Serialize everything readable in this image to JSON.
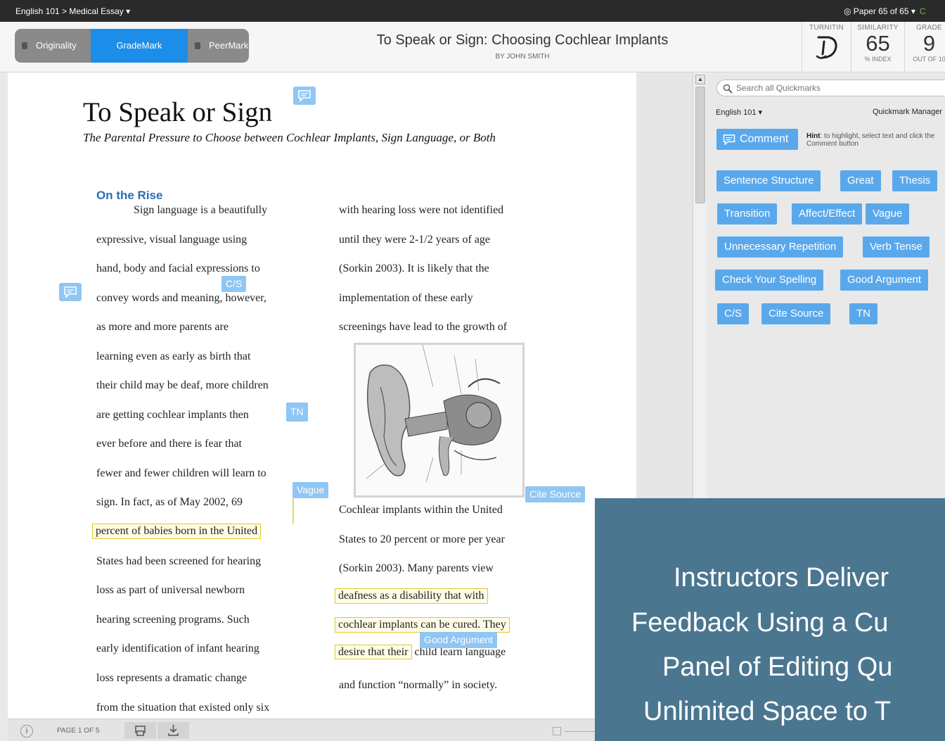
{
  "topbar": {
    "breadcrumb": "English 101 > Medical Essay ▾",
    "paper_nav": "◎  Paper 65 of 65 ▾",
    "next": "C"
  },
  "modes": {
    "originality": "Originality",
    "grademark": "GradeMark",
    "peermark": "PeerMark"
  },
  "document": {
    "title": "To Speak or Sign: Choosing Cochlear Implants",
    "author": "BY JOHN SMITH"
  },
  "scores": {
    "turnitin_label": "TURNITIN",
    "similarity_label": "SIMILARITY",
    "similarity_value": "65",
    "similarity_sub": "% INDEX",
    "grade_label": "GRADE",
    "grade_value": "9",
    "grade_sub": "OUT OF 10"
  },
  "essay": {
    "title": "To Speak or Sign",
    "subtitle": "The Parental Pressure to Choose between Cochlear Implants, Sign Language, or Both",
    "section_heading": "On the Rise",
    "col1": [
      "Sign language is a beautifully",
      "expressive, visual language using",
      "hand, body and facial expressions to",
      "convey words and meaning, however,",
      "as more and more parents are",
      "learning even as early as birth that",
      "their child may be deaf, more children",
      "are getting cochlear implants then",
      "ever before and there is fear that",
      "fewer and fewer children will learn to",
      "sign.  In fact, as of May 2002, 69",
      "percent of babies born in the United",
      "States had been screened for hearing",
      "loss as part of universal newborn",
      "hearing screening programs. Such",
      "early identification of infant hearing",
      "loss represents a dramatic change",
      "from the situation that existed only six"
    ],
    "col2_top": [
      "with hearing loss were not identified",
      "until they were 2-1/2 years of age",
      "(Sorkin 2003).  It is likely that the",
      "implementation of these early",
      "screenings have lead to the growth of"
    ],
    "col2_bottom": [
      "Cochlear implants within the United",
      "States to 20 percent or more per year",
      "(Sorkin 2003).  Many parents view",
      "deafness as a disability that with",
      "cochlear implants can be cured.  They",
      "desire that their",
      " child learn language",
      "and function “normally” in society."
    ],
    "tags": {
      "cs": "C/S",
      "tn": "TN",
      "vague": "Vague",
      "cite_source": "Cite Source",
      "good_argument": "Good Argument"
    }
  },
  "bottombar": {
    "info": "i",
    "page_indicator": "PAGE 1 OF 5"
  },
  "quickmarks": {
    "search_placeholder": "Search all Quickmarks",
    "set_name": "English 101 ▾",
    "manager": "Quickmark Manager",
    "comment_label": "Comment",
    "hint_bold": "Hint",
    "hint_text": ": to highlight, select text and click the Comment button",
    "buttons": [
      "Sentence Structure",
      "Great",
      "Thesis",
      "Transition",
      "Affect/Effect",
      "Vague",
      "Unnecessary Repetition",
      "Verb Tense",
      "Check Your Spelling",
      "Good Argument",
      "C/S",
      "Cite Source",
      "TN"
    ]
  },
  "overlay": {
    "lines": [
      "Instructors Deliver",
      "Feedback Using a Cu",
      "Panel of Editing Qu",
      "Unlimited Space to T"
    ]
  },
  "colors": {
    "accent_blue": "#1c8de8",
    "quickmark_blue": "#5aa8ec",
    "tag_blue": "#8fc6f4",
    "highlight_yellow": "#e3c82b",
    "overlay_teal": "#4b7690"
  }
}
